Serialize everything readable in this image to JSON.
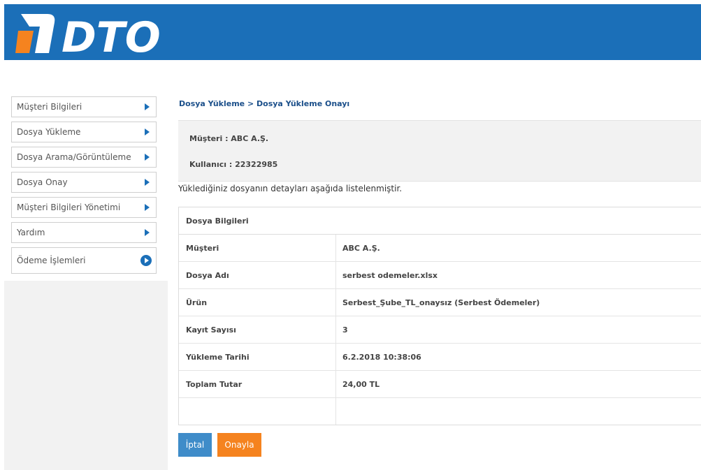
{
  "header": {
    "logo_text": "DTO"
  },
  "colors": {
    "brand_blue": "#1b6fb8",
    "accent_orange": "#f5831f",
    "button_blue": "#3f8cc9"
  },
  "sidebar": {
    "items": [
      {
        "label": "Müşteri Bilgileri",
        "icon": "arrow-right-icon"
      },
      {
        "label": "Dosya Yükleme",
        "icon": "arrow-right-icon"
      },
      {
        "label": "Dosya Arama/Görüntüleme",
        "icon": "arrow-right-icon"
      },
      {
        "label": "Dosya Onay",
        "icon": "arrow-right-icon"
      },
      {
        "label": "Müşteri Bilgileri Yönetimi",
        "icon": "arrow-right-icon"
      },
      {
        "label": "Yardım",
        "icon": "arrow-right-icon"
      },
      {
        "label": "Ödeme İşlemleri",
        "icon": "play-circle-icon"
      }
    ]
  },
  "breadcrumb": {
    "part1": "Dosya Yükleme",
    "separator": ">",
    "part2": "Dosya Yükleme Onayı"
  },
  "info": {
    "customer": "Müşteri :  ABC A.Ş.",
    "user": "Kullanıcı : 22322985"
  },
  "description": "Yüklediğiniz dosyanın detayları aşağıda listelenmiştir.",
  "file_table": {
    "title": "Dosya Bilgileri",
    "rows": [
      {
        "label": "Müşteri",
        "value": "ABC A.Ş."
      },
      {
        "label": "Dosya Adı",
        "value": "serbest odemeler.xlsx"
      },
      {
        "label": "Ürün",
        "value": "Serbest_Şube_TL_onaysız (Serbest Ödemeler)"
      },
      {
        "label": "Kayıt Sayısı",
        "value": "3"
      },
      {
        "label": "Yükleme Tarihi",
        "value": "6.2.2018 10:38:06"
      },
      {
        "label": "Toplam Tutar",
        "value": "24,00 TL"
      },
      {
        "label": "",
        "value": ""
      }
    ]
  },
  "actions": {
    "cancel_label": "İptal",
    "approve_label": "Onayla"
  }
}
